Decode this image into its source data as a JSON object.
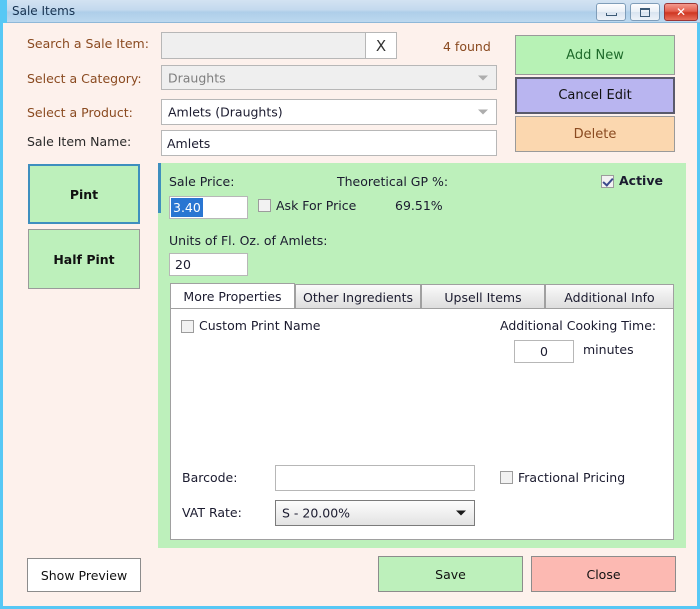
{
  "window": {
    "title": "Sale Items",
    "controls": {
      "minimize": "minimize-button",
      "maximize": "maximize-button",
      "close": "✕"
    },
    "border_color": "#57c8f5",
    "background": "#fdf1ec"
  },
  "form": {
    "search_label": "Search a Sale Item:",
    "search_value": "",
    "search_placeholder": "",
    "search_clear_label": "X",
    "found_text": "4 found",
    "category_label": "Select a Category:",
    "category_value": "Draughts",
    "product_label": "Select a Product:",
    "product_value": "Amlets (Draughts)",
    "sale_item_name_label": "Sale Item Name:",
    "sale_item_name_value": "Amlets"
  },
  "actions": {
    "add_new": "Add New",
    "cancel_edit": "Cancel Edit",
    "delete": "Delete"
  },
  "sizes": [
    {
      "label": "Pint",
      "selected": true
    },
    {
      "label": "Half Pint",
      "selected": false
    }
  ],
  "details": {
    "sale_price_label": "Sale Price:",
    "sale_price_value": "3.40",
    "ask_for_price_label": "Ask For Price",
    "ask_for_price_checked": false,
    "theoretical_gp_label": "Theoretical GP %:",
    "theoretical_gp_value": "69.51%",
    "active_label": "Active",
    "active_checked": true,
    "units_label": "Units of Fl. Oz. of Amlets:",
    "units_value": "20"
  },
  "tabs": [
    {
      "label": "More Properties",
      "active": true
    },
    {
      "label": "Other Ingredients",
      "active": false
    },
    {
      "label": "Upsell Items",
      "active": false
    },
    {
      "label": "Additional Info",
      "active": false
    }
  ],
  "more_properties": {
    "custom_print_name_label": "Custom Print Name",
    "custom_print_name_checked": false,
    "cooking_time_label": "Additional Cooking Time:",
    "cooking_time_value": "0",
    "cooking_time_units": "minutes",
    "barcode_label": "Barcode:",
    "barcode_value": "",
    "fractional_pricing_label": "Fractional Pricing",
    "fractional_pricing_checked": false,
    "vat_rate_label": "VAT Rate:",
    "vat_rate_value": "S - 20.00%"
  },
  "footer": {
    "show_preview": "Show Preview",
    "save": "Save",
    "close": "Close"
  },
  "colors": {
    "accent_green": "#bdf0bb",
    "accent_purple": "#b9b5f0",
    "accent_orange": "#fbd7af",
    "accent_red": "#fcb9b2",
    "label_brown": "#8a4a20",
    "selection_blue": "#3e8fbe"
  }
}
